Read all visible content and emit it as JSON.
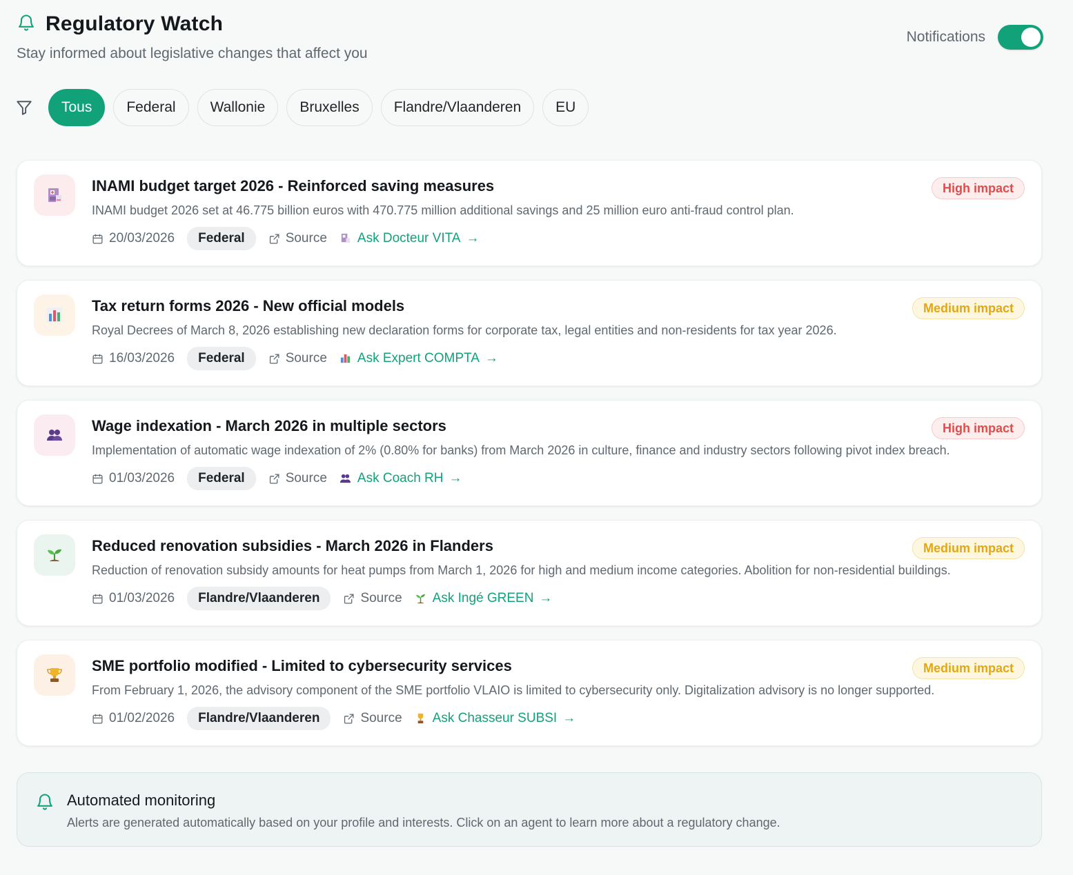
{
  "header": {
    "title": "Regulatory Watch",
    "subtitle": "Stay informed about legislative changes that affect you",
    "bell_icon": "bell-icon",
    "notifications_label": "Notifications",
    "notifications_on": true
  },
  "filters": {
    "icon": "filter-icon",
    "chips": [
      "Tous",
      "Federal",
      "Wallonie",
      "Bruxelles",
      "Flandre/Vlaanderen",
      "EU"
    ],
    "active": "Tous"
  },
  "alerts": [
    {
      "icon": "hospital-icon",
      "title": "INAMI budget target 2026 - Reinforced saving measures",
      "description": "INAMI budget 2026 set at 46.775 billion euros with 470.775 million additional savings and 25 million euro anti-fraud control plan.",
      "date": "20/03/2026",
      "region": "Federal",
      "source_label": "Source",
      "ask_label": "Ask Docteur VITA",
      "impact": "High impact",
      "impact_level": "high"
    },
    {
      "icon": "bar-chart-icon",
      "title": "Tax return forms 2026 - New official models",
      "description": "Royal Decrees of March 8, 2026 establishing new declaration forms for corporate tax, legal entities and non-residents for tax year 2026.",
      "date": "16/03/2026",
      "region": "Federal",
      "source_label": "Source",
      "ask_label": "Ask Expert COMPTA",
      "impact": "Medium impact",
      "impact_level": "medium"
    },
    {
      "icon": "people-icon",
      "title": "Wage indexation - March 2026 in multiple sectors",
      "description": "Implementation of automatic wage indexation of 2% (0.80% for banks) from March 2026 in culture, finance and industry sectors following pivot index breach.",
      "date": "01/03/2026",
      "region": "Federal",
      "source_label": "Source",
      "ask_label": "Ask Coach RH",
      "impact": "High impact",
      "impact_level": "high"
    },
    {
      "icon": "seedling-icon",
      "title": "Reduced renovation subsidies - March 2026 in Flanders",
      "description": "Reduction of renovation subsidy amounts for heat pumps from March 1, 2026 for high and medium income categories. Abolition for non-residential buildings.",
      "date": "01/03/2026",
      "region": "Flandre/Vlaanderen",
      "source_label": "Source",
      "ask_label": "Ask Ingé GREEN",
      "impact": "Medium impact",
      "impact_level": "medium"
    },
    {
      "icon": "trophy-icon",
      "title": "SME portfolio modified - Limited to cybersecurity services",
      "description": "From February 1, 2026, the advisory component of the SME portfolio VLAIO is limited to cybersecurity only. Digitalization advisory is no longer supported.",
      "date": "01/02/2026",
      "region": "Flandre/Vlaanderen",
      "source_label": "Source",
      "ask_label": "Ask Chasseur SUBSI",
      "impact": "Medium impact",
      "impact_level": "medium"
    }
  ],
  "info": {
    "icon": "bell-icon",
    "title": "Automated monitoring",
    "description": "Alerts are generated automatically based on your profile and interests. Click on an agent to learn more about a regulatory change."
  },
  "colors": {
    "accent": "#12a27a",
    "high": "#e14b4b",
    "medium": "#e3a712"
  }
}
